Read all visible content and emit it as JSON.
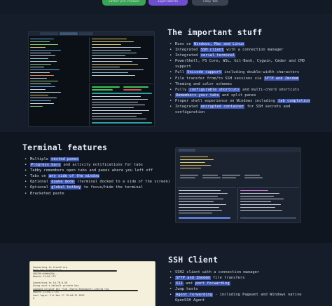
{
  "top_buttons": [
    {
      "label": "Latest pre-release",
      "color": "#3aa356"
    },
    {
      "label": "Experimental",
      "color": "#6e4fd0"
    },
    {
      "label": "Tabby Web",
      "color": "#3a4150"
    }
  ],
  "sections": {
    "important": {
      "title": "The important stuff",
      "items": [
        {
          "pre": "Runs on ",
          "hl": "Windows, Mac and Linux",
          "post": ""
        },
        {
          "pre": "Integrated ",
          "hl": "SSH client",
          "post": " with a connection manager"
        },
        {
          "pre": "Integrated ",
          "hl": "serial terminal",
          "post": ""
        },
        {
          "pre": "PowerShell, PS Core, WSL, Git-Bash, Cygwin, Cmder and CMD",
          "hl": "",
          "post": ""
        },
        {
          "pre": "support",
          "hl": "",
          "post": "",
          "continuation": true
        },
        {
          "pre": "Full ",
          "hl": "Unicode support",
          "post": " including double-width characters"
        },
        {
          "pre": "File transfer from/to SSH sessions via ",
          "hl": "SFTP and Zmodem",
          "post": ""
        },
        {
          "pre": "Theming and color schemes",
          "hl": "",
          "post": ""
        },
        {
          "pre": "Fully ",
          "hl": "configurable shortcuts",
          "post": " and multi-chord shortcuts"
        },
        {
          "pre": "",
          "hl": "Remembers your tabs",
          "post": " and split panes"
        },
        {
          "pre": "Proper shell experience on Windows including ",
          "hl": "tab completion",
          "post": ""
        },
        {
          "pre": "Integrated ",
          "hl": "encrypted container",
          "post": " for SSH secrets and"
        },
        {
          "pre": "configuration",
          "hl": "",
          "post": "",
          "continuation": true
        }
      ]
    },
    "terminal": {
      "title": "Terminal features",
      "items": [
        {
          "pre": "Multiple ",
          "hl": "nested panes",
          "post": ""
        },
        {
          "pre": "",
          "hl": "Progress bars",
          "post": " and activity notifications for tabs"
        },
        {
          "pre": "Tabby remembers open tabs and panes where you left off",
          "hl": "",
          "post": ""
        },
        {
          "pre": "Tabs on ",
          "hl": "any side of the window",
          "post": ""
        },
        {
          "pre": "Optional ",
          "hl": "quake mode",
          "post": " (terminal docked to a side of the screen)"
        },
        {
          "pre": "Optional ",
          "hl": "global hotkey",
          "post": " to focus/hide the terminal"
        },
        {
          "pre": "Bracketed paste",
          "hl": "",
          "post": ""
        }
      ]
    },
    "ssh": {
      "title": "SSH Client",
      "items": [
        {
          "pre": "SSH2 client with a connection manager",
          "hl": "",
          "post": ""
        },
        {
          "pre": "",
          "hl": "SFTP and Zmodem",
          "post": " file transfers"
        },
        {
          "pre": "",
          "hl": "X11",
          "post": " and "
        },
        {
          "pre": "Jump hosts",
          "hl": "",
          "post": ""
        },
        {
          "pre": "",
          "hl": "Agent forwarding",
          "post": " - including Pageant and Windows native"
        },
        {
          "pre": "OpenSSH Agent",
          "hl": "",
          "post": "",
          "continuation": true
        }
      ],
      "extra_hl": "port forwarding"
    }
  },
  "ssh_shot_text": "Connecting to ticoth.org\nHost key fingerprint:\nSHA256:h8aNx1Dm...\nUbuntu 24.04 LTS\n\nConnecting to 10.70.0.56\nUsing user's default private key\nLoading private key from /Users/tegyeport/.ssh/id_rsa\nUbuntu 22.04.2 LTS\nLast login: Fri Nov 17 19:04:12 2023\n$ "
}
